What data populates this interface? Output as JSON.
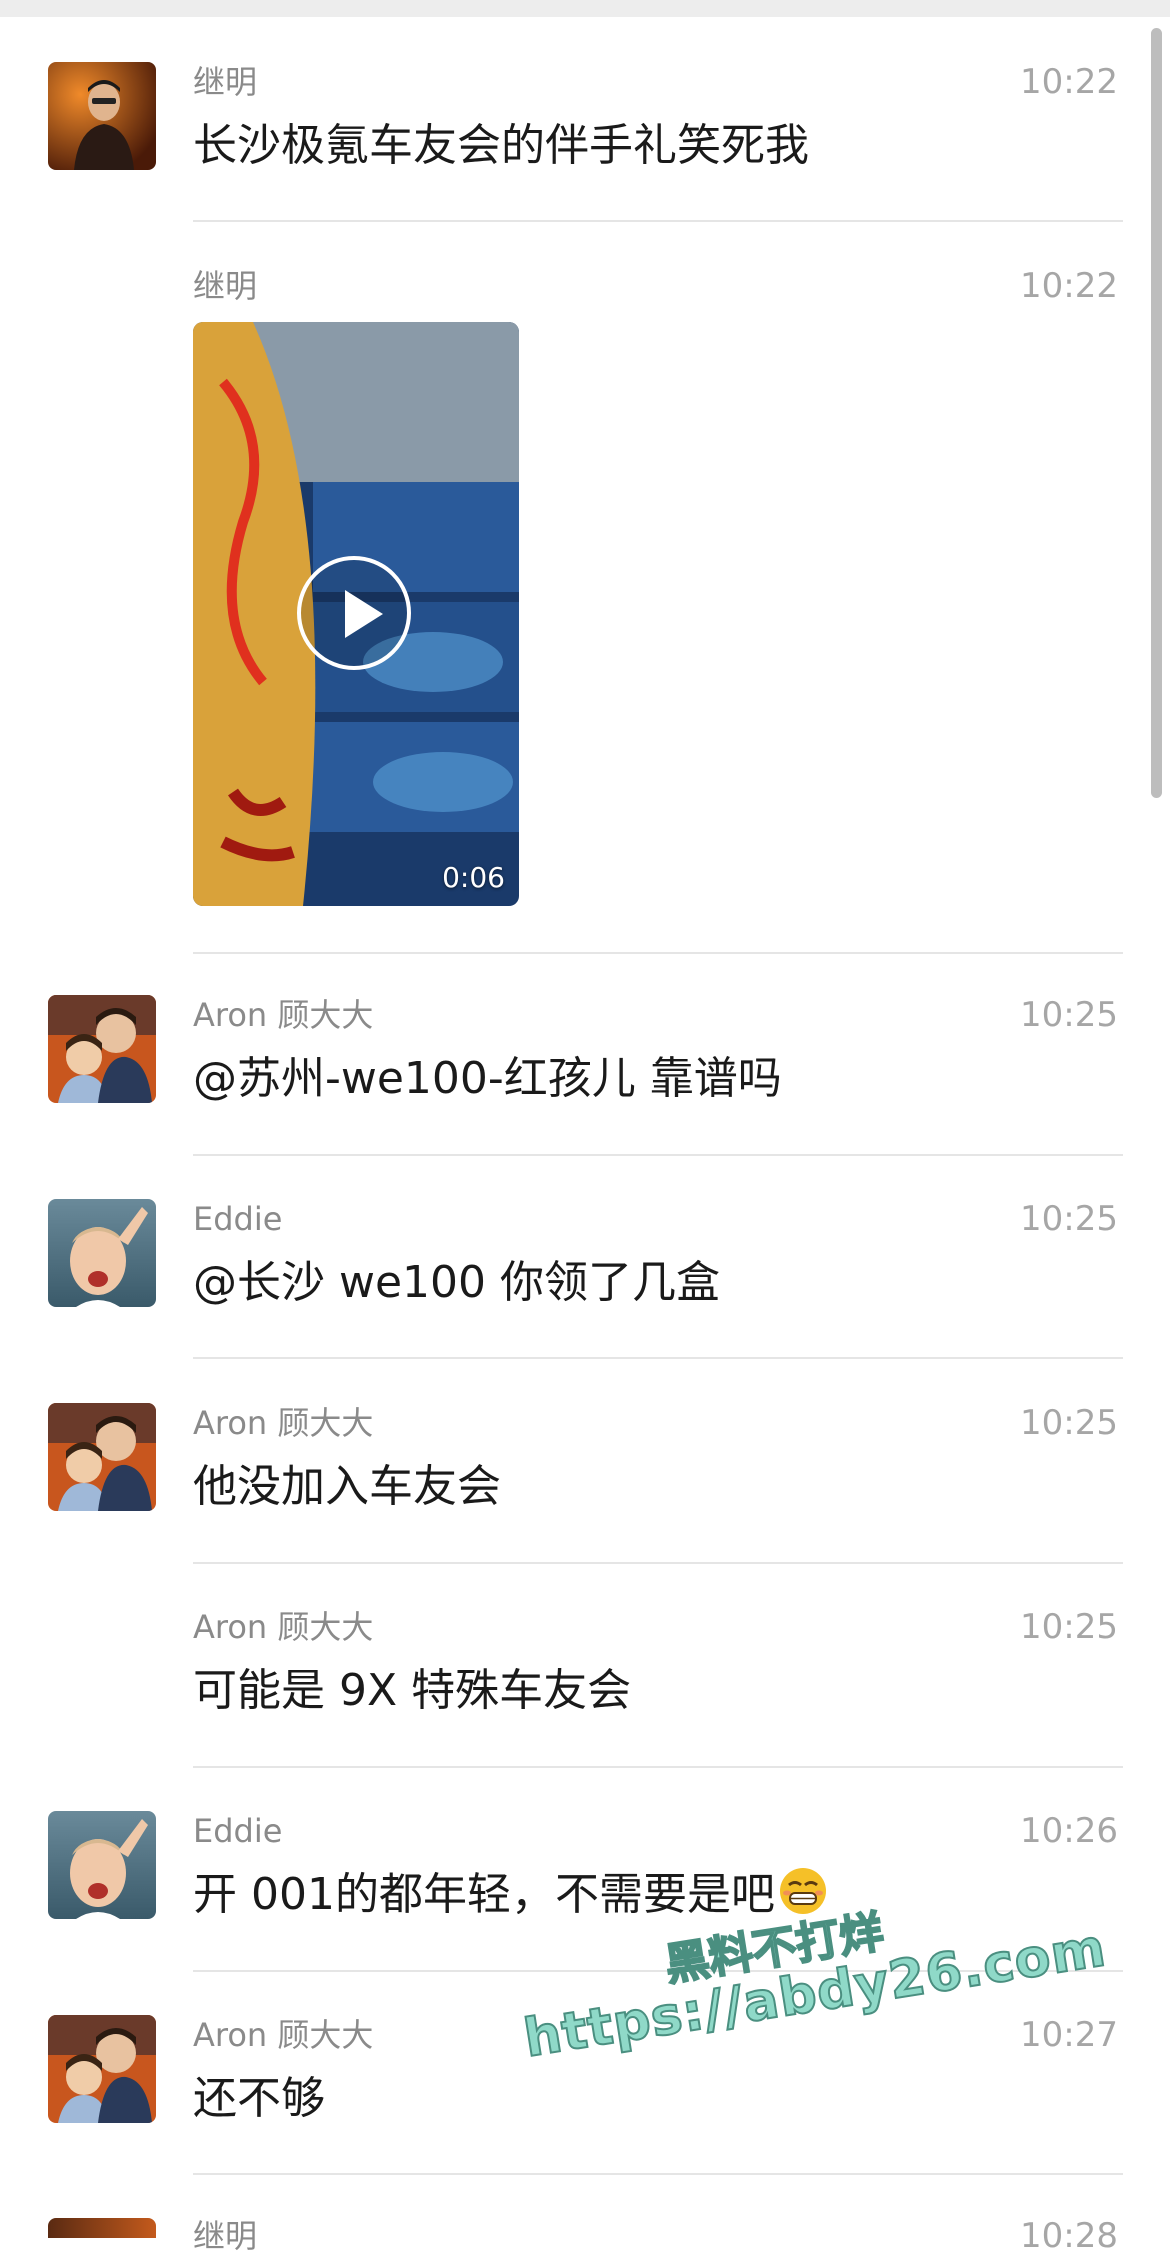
{
  "messages": [
    {
      "sender": "继明",
      "time": "10:22",
      "text": "长沙极氪车友会的伴手礼笑死我",
      "avatar": "jiming-avatar"
    },
    {
      "sender": "继明",
      "time": "10:22",
      "video_duration": "0:06"
    },
    {
      "sender": "Aron 顾大大",
      "time": "10:25",
      "text": "@苏州-we100-红孩儿 靠谱吗",
      "avatar": "aron-avatar"
    },
    {
      "sender": "Eddie",
      "time": "10:25",
      "text": "@长沙 we100 你领了几盒",
      "avatar": "eddie-avatar"
    },
    {
      "sender": "Aron 顾大大",
      "time": "10:25",
      "text": "他没加入车友会",
      "avatar": "aron-avatar"
    },
    {
      "sender": "Aron 顾大大",
      "time": "10:25",
      "text": "可能是 9X 特殊车友会"
    },
    {
      "sender": "Eddie",
      "time": "10:26",
      "text": "开 001的都年轻，不需要是吧",
      "emoji": "grimace-emoji",
      "avatar": "eddie-avatar"
    },
    {
      "sender": "Aron 顾大大",
      "time": "10:27",
      "text": "还不够",
      "avatar": "aron-avatar"
    },
    {
      "sender": "继明",
      "time": "10:28",
      "partial": true
    }
  ],
  "watermark": {
    "line1": "黑料不打烊",
    "line2": "https://abdy26.com"
  }
}
